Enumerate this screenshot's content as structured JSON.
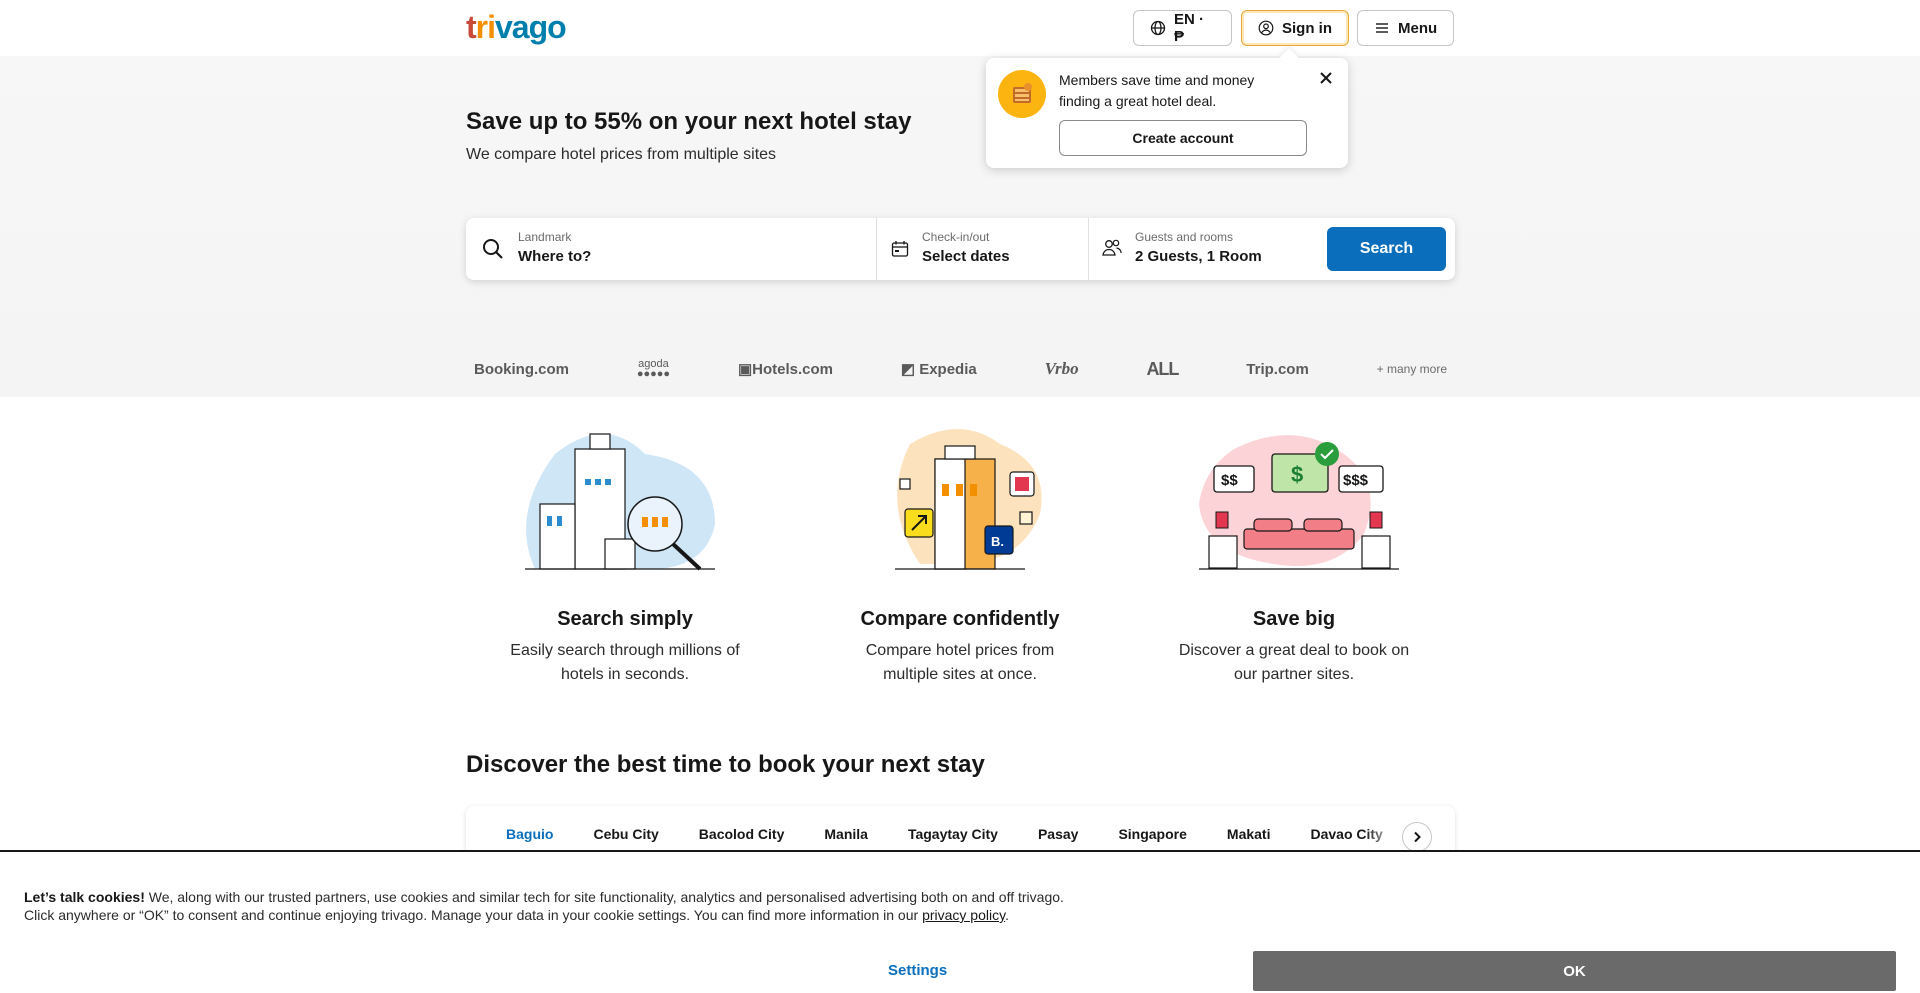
{
  "header": {
    "logo": {
      "part1": "t",
      "part2": "ri",
      "part3": "vago"
    },
    "language_label": "EN · ₱",
    "signin_label": "Sign in",
    "menu_label": "Menu"
  },
  "popover": {
    "message": "Members save time and money finding a great hotel deal.",
    "create_account_label": "Create account"
  },
  "hero": {
    "title": "Save up to 55% on your next hotel stay",
    "subtitle": "We compare hotel prices from multiple sites"
  },
  "search": {
    "destination_label": "Landmark",
    "destination_value": "Where to?",
    "dates_label": "Check-in/out",
    "dates_value": "Select dates",
    "guests_label": "Guests and rooms",
    "guests_value": "2 Guests, 1 Room",
    "search_label": "Search"
  },
  "partners": {
    "booking": "Booking.com",
    "agoda": "agoda",
    "hotels": "Hotels.com",
    "expedia": "Expedia",
    "vrbo": "Vrbo",
    "all": "ALL",
    "trip": "Trip.com",
    "more": "+ many more"
  },
  "features": [
    {
      "title": "Search simply",
      "text": "Easily search through millions of hotels in seconds."
    },
    {
      "title": "Compare confidently",
      "text": "Compare hotel prices from multiple sites at once."
    },
    {
      "title": "Save big",
      "text": "Discover a great deal to book on our partner sites."
    }
  ],
  "discover": {
    "title": "Discover the best time to book your next stay",
    "tabs": [
      "Baguio",
      "Cebu City",
      "Bacolod City",
      "Manila",
      "Tagaytay City",
      "Pasay",
      "Singapore",
      "Makati",
      "Davao City"
    ],
    "active_tab": "Baguio"
  },
  "cookie": {
    "heading": "Let’s talk cookies!",
    "line1": " We, along with our trusted partners, use cookies and similar tech for site functionality, analytics and personalised advertising both on and off trivago.",
    "line2": "Click anywhere or “OK” to consent and continue enjoying trivago. Manage your data in your cookie settings. You can find more information in our ",
    "policy_link": "privacy policy",
    "line2_end": ".",
    "settings_label": "Settings",
    "ok_label": "OK"
  },
  "colors": {
    "brand_red": "#c94a38",
    "brand_orange": "#f48f00",
    "brand_blue": "#007fad",
    "primary_button": "#0a6ebd",
    "ok_button": "#6a6a6a"
  }
}
